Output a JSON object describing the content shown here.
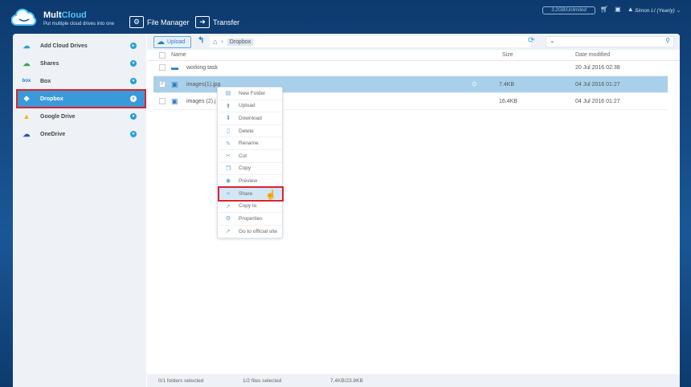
{
  "header": {
    "brand_a": "Mult",
    "brand_b": "Cloud",
    "tagline": "Put multiple cloud drives into one",
    "nav": [
      {
        "label": "File Manager"
      },
      {
        "label": "Transfer"
      }
    ],
    "quota": "3.2GB/Unlimited",
    "user": "Simon LI (Yearly)"
  },
  "sidebar": {
    "items": [
      {
        "label": "Add Cloud Drives",
        "icon": "cloud-plus-icon",
        "color": "#2a9fd6"
      },
      {
        "label": "Shares",
        "icon": "share-icon",
        "color": "#3aa84a"
      },
      {
        "label": "Box",
        "icon": "box-icon",
        "color": "#2a7bc4"
      },
      {
        "label": "Dropbox",
        "icon": "dropbox-icon",
        "color": "#ffffff"
      },
      {
        "label": "Google Drive",
        "icon": "google-drive-icon",
        "color": "#f4b400"
      },
      {
        "label": "OneDrive",
        "icon": "onedrive-icon",
        "color": "#1a5bb0"
      }
    ]
  },
  "toolbar": {
    "upload": "Upload",
    "breadcrumb": "Dropbox"
  },
  "table": {
    "columns": [
      "Name",
      "Size",
      "Date modified"
    ],
    "rows": [
      {
        "name": "working task",
        "size": "",
        "date": "20 Jul 2016 02:38",
        "type": "folder",
        "checked": false
      },
      {
        "name": "images(1).jpg",
        "size": "7.4KB",
        "date": "04 Jul 2016 01:27",
        "type": "image",
        "checked": true
      },
      {
        "name": "images (2).j",
        "size": "16.4KB",
        "date": "04 Jul 2016 01:27",
        "type": "image",
        "checked": false
      }
    ]
  },
  "context_menu": {
    "items": [
      "New Folder",
      "Upload",
      "Download",
      "Delete",
      "Rename",
      "Cut",
      "Copy",
      "Preview",
      "Share",
      "Copy to",
      "Properties",
      "Go to official site"
    ],
    "highlighted": "Share"
  },
  "status": {
    "folders": "0/1 folders selected",
    "files": "1/2 files selected",
    "size": "7.4KB/23.8KB"
  }
}
